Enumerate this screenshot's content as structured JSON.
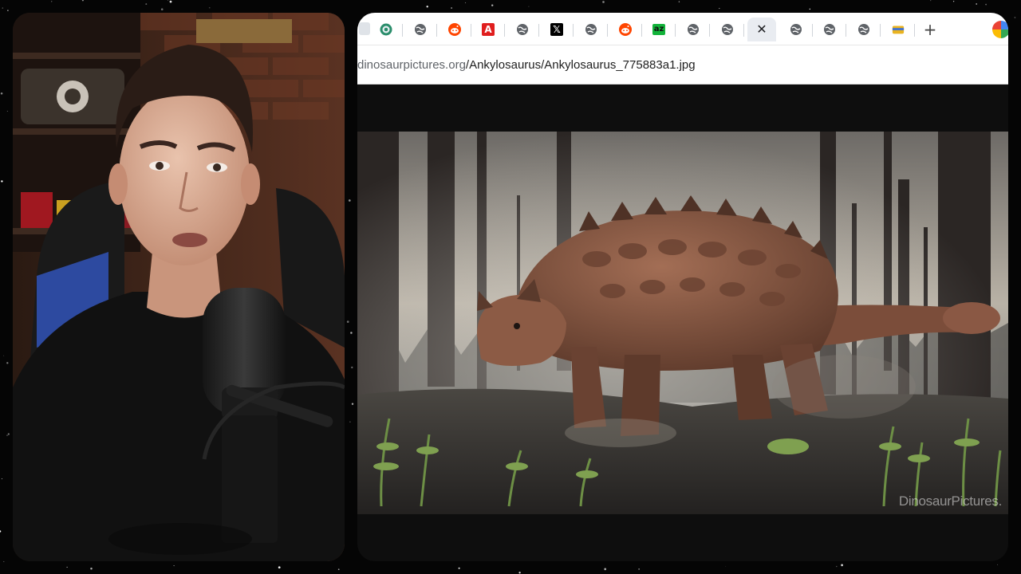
{
  "browser": {
    "tabs": [
      {
        "icon": "wikipedia-icon",
        "active": false
      },
      {
        "icon": "globe-icon",
        "active": false
      },
      {
        "icon": "reddit-icon",
        "active": false
      },
      {
        "icon": "adobe-icon",
        "active": false,
        "glyph": "A"
      },
      {
        "icon": "globe-icon",
        "active": false
      },
      {
        "icon": "x-icon",
        "active": false,
        "glyph": "𝕏"
      },
      {
        "icon": "globe-icon",
        "active": false
      },
      {
        "icon": "reddit-icon",
        "active": false
      },
      {
        "icon": "az-icon",
        "active": false,
        "glyph": "az"
      },
      {
        "icon": "globe-icon",
        "active": false
      },
      {
        "icon": "globe-icon",
        "active": false
      },
      {
        "icon": "close-icon",
        "active": true,
        "glyph": "✕"
      },
      {
        "icon": "globe-icon",
        "active": false
      },
      {
        "icon": "globe-icon",
        "active": false
      },
      {
        "icon": "globe-icon",
        "active": false
      },
      {
        "icon": "bookmark-folder-icon",
        "active": false
      }
    ],
    "new_tab_glyph": "+",
    "address": {
      "domain": "dinosaurpictures.org",
      "path": "/Ankylosaurus/Ankylosaurus_775883a1.jpg"
    },
    "watermark": "DinosaurPictures."
  },
  "colors": {
    "page_background": "#050505",
    "tab_active": "#e9ecf1",
    "reddit": "#ff4500",
    "adobe": "#e01e1e",
    "az": "#12b33a"
  }
}
